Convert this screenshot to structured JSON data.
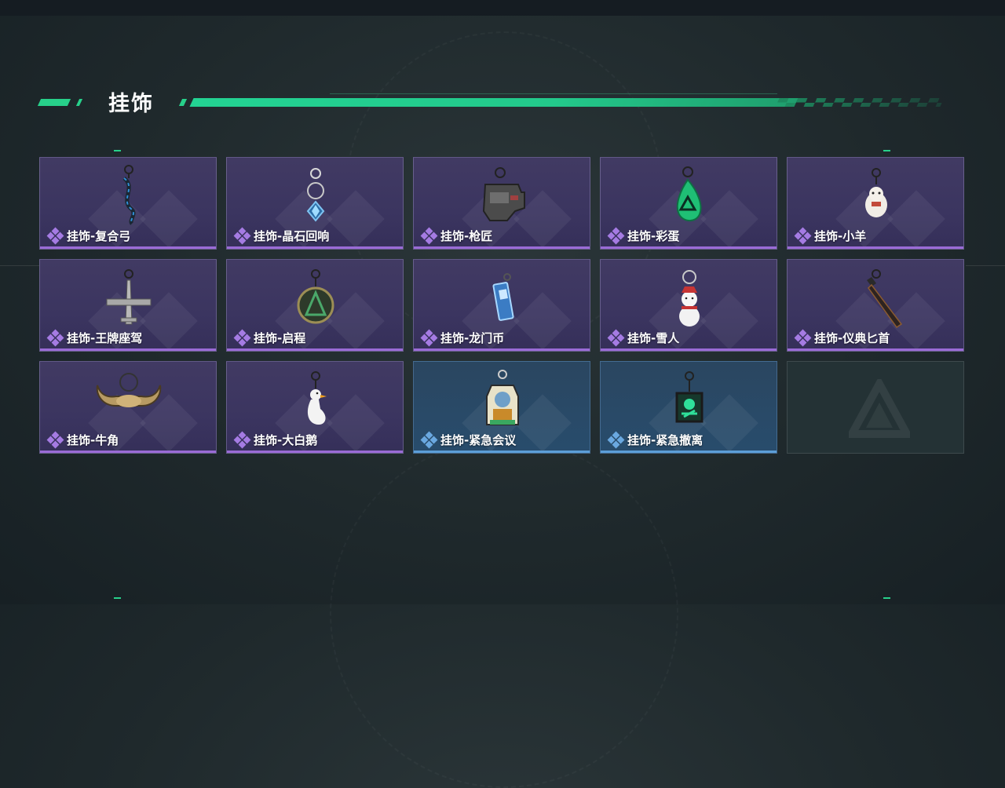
{
  "header": {
    "title": "挂饰"
  },
  "colors": {
    "accent": "#27d08a",
    "epic": "#9a6bd6",
    "rare": "#5c9ed8"
  },
  "items": [
    {
      "label": "挂饰-复合弓",
      "rarity": "epic",
      "icon": "compound-bow-charm-icon"
    },
    {
      "label": "挂饰-晶石回响",
      "rarity": "epic",
      "icon": "crystal-charm-icon"
    },
    {
      "label": "挂饰-枪匠",
      "rarity": "epic",
      "icon": "gunsmith-charm-icon"
    },
    {
      "label": "挂饰-彩蛋",
      "rarity": "epic",
      "icon": "easter-egg-charm-icon"
    },
    {
      "label": "挂饰-小羊",
      "rarity": "epic",
      "icon": "lamb-charm-icon"
    },
    {
      "label": "挂饰-王牌座驾",
      "rarity": "epic",
      "icon": "aircraft-charm-icon"
    },
    {
      "label": "挂饰-启程",
      "rarity": "epic",
      "icon": "departure-coin-charm-icon"
    },
    {
      "label": "挂饰-龙门币",
      "rarity": "epic",
      "icon": "longmen-coin-charm-icon"
    },
    {
      "label": "挂饰-雪人",
      "rarity": "epic",
      "icon": "snowman-charm-icon"
    },
    {
      "label": "挂饰-仪典匕首",
      "rarity": "epic",
      "icon": "ceremonial-dagger-charm-icon"
    },
    {
      "label": "挂饰-牛角",
      "rarity": "epic",
      "icon": "horns-charm-icon"
    },
    {
      "label": "挂饰-大白鹅",
      "rarity": "epic",
      "icon": "goose-charm-icon"
    },
    {
      "label": "挂饰-紧急会议",
      "rarity": "rare",
      "icon": "emergency-meeting-charm-icon"
    },
    {
      "label": "挂饰-紧急撤离",
      "rarity": "rare",
      "icon": "emergency-evac-charm-icon"
    }
  ]
}
